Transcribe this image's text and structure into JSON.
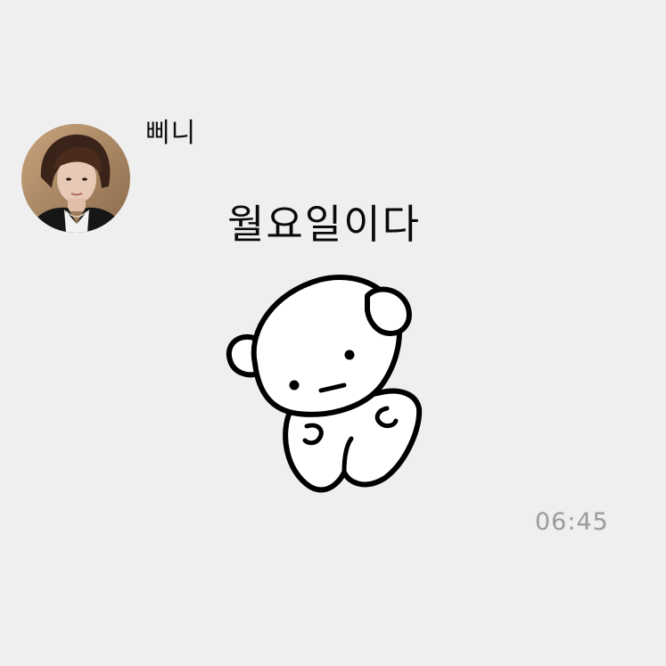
{
  "chat": {
    "sender_name": "삐니",
    "message_text": "월요일이다",
    "timestamp": "06:45"
  },
  "avatar": {
    "icon": "profile-photo"
  },
  "sticker": {
    "icon": "white-bear-sticker"
  },
  "colors": {
    "background": "#efefef",
    "text": "#111111",
    "timestamp": "#9b9b9b"
  }
}
